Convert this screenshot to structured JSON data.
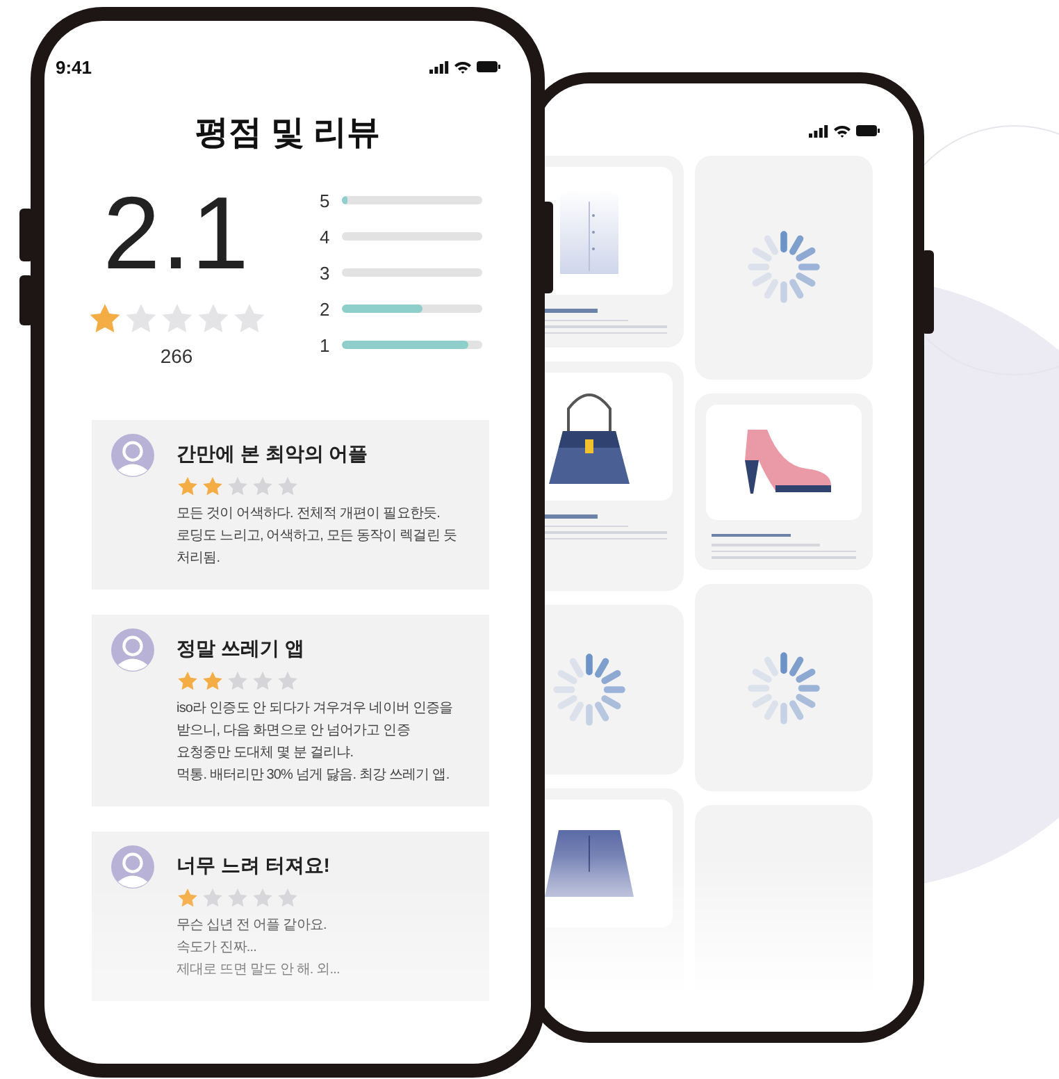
{
  "front_phone": {
    "status_bar": {
      "time": "9:41"
    },
    "title": "평점 및 리뷰",
    "rating": {
      "value": "2.1",
      "stars": 1,
      "count": "266"
    },
    "distribution": [
      {
        "label": "5",
        "level": 0.04
      },
      {
        "label": "4",
        "level": 0
      },
      {
        "label": "3",
        "level": 0
      },
      {
        "label": "2",
        "level": 0.57
      },
      {
        "label": "1",
        "level": 0.9
      }
    ],
    "reviews": [
      {
        "title": "간만에 본 최악의 어플",
        "stars": 2,
        "lines": [
          "모든 것이 어색하다. 전체적 개편이 필요한듯.",
          "로딩도 느리고, 어색하고, 모든 동작이 렉걸린 듯",
          "처리됨."
        ]
      },
      {
        "title": "정말 쓰레기 앱",
        "stars": 2,
        "lines": [
          "iso라 인증도 안 되다가 겨우겨우 네이버 인증을",
          "받으니, 다음 화면으로 안 넘어가고 인증",
          "요청중만 도대체 몇 분 걸리냐.",
          "먹통. 배터리만 30% 넘게 닳음. 최강 쓰레기 앱."
        ]
      },
      {
        "title": "너무 느려 터져요!",
        "stars": 1,
        "lines": [
          "무슨 십년 전 어플 같아요.",
          "속도가 진짜...",
          "제대로 뜨면 말도 안 해. 외..."
        ]
      }
    ]
  },
  "back_phone": {
    "columns": [
      [
        {
          "kind": "shirt"
        },
        {
          "kind": "bag"
        },
        {
          "kind": "spinner"
        },
        {
          "kind": "skirt"
        }
      ],
      [
        {
          "kind": "spinner"
        },
        {
          "kind": "shoe"
        },
        {
          "kind": "spinner"
        },
        {
          "kind": "empty"
        }
      ]
    ]
  }
}
